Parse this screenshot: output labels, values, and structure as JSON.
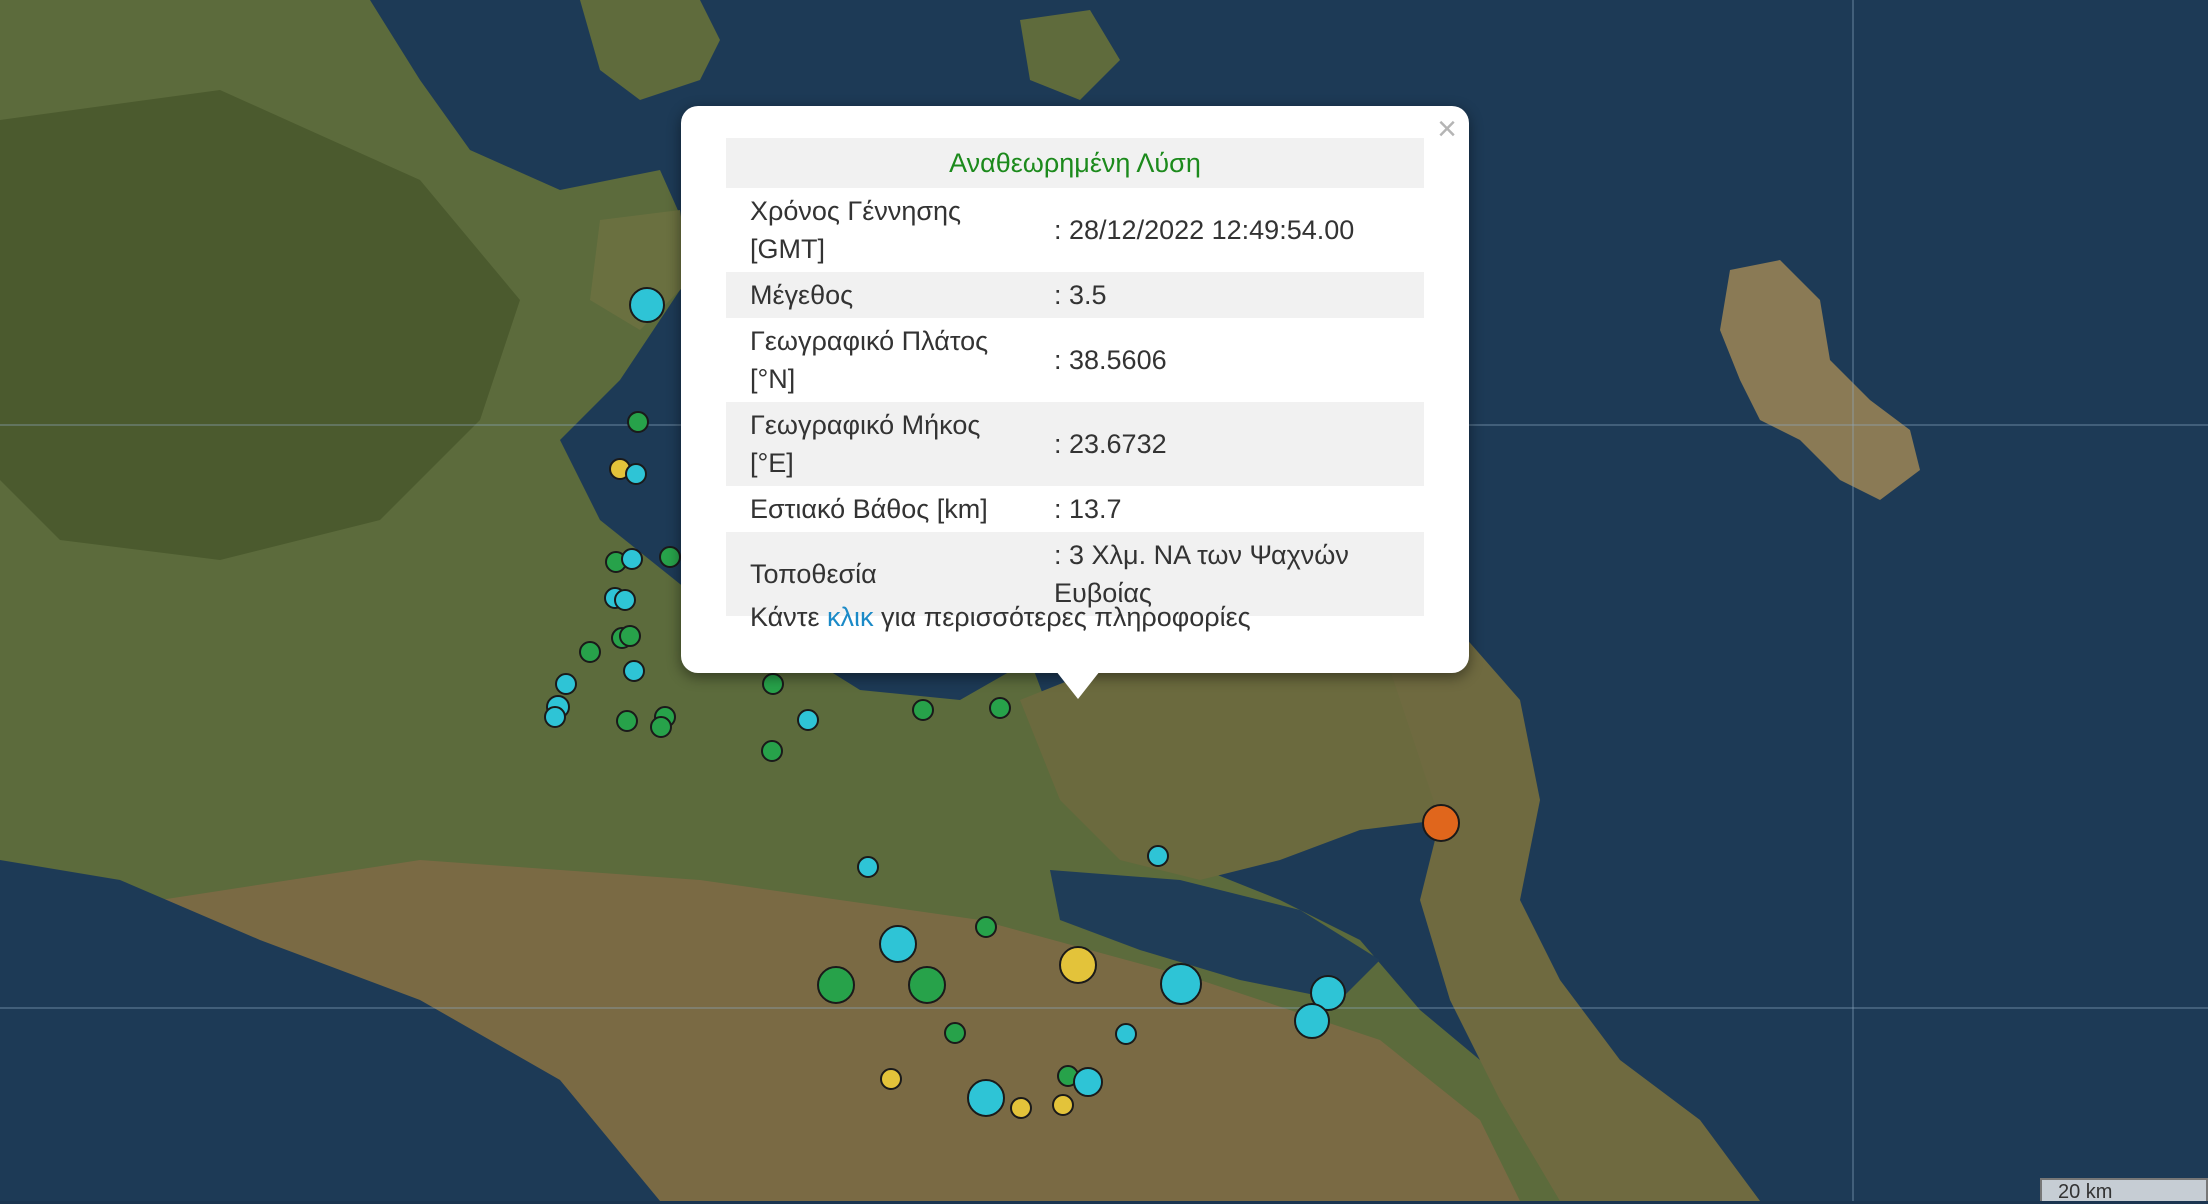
{
  "popup": {
    "close_label": "×",
    "title": "Αναθεωρημένη Λύση",
    "rows": [
      {
        "label": "Χρόνος Γέννησης [GMT]",
        "value": ": 28/12/2022 12:49:54.00"
      },
      {
        "label": "Μέγεθος",
        "value": ": 3.5"
      },
      {
        "label": "Γεωγραφικό Πλάτος [°N]",
        "value": ": 38.5606"
      },
      {
        "label": "Γεωγραφικό Μήκος [°E]",
        "value": ": 23.6732"
      },
      {
        "label": "Εστιακό Βάθος [km]",
        "value": ": 13.7"
      },
      {
        "label": "Τοποθεσία",
        "value": ": 3 Χλμ. ΝΑ των Ψαχνών Ευβοίας"
      }
    ],
    "more_prefix": "Κάντε ",
    "more_link": "κλικ",
    "more_suffix": " για περισσότερες πληροφορίες"
  },
  "scale": {
    "label": "20 km"
  },
  "marker_colors": {
    "cyan": "#2ec4d6",
    "green": "#27a24a",
    "yellow": "#e3c33a",
    "orange": "#e0661c"
  }
}
